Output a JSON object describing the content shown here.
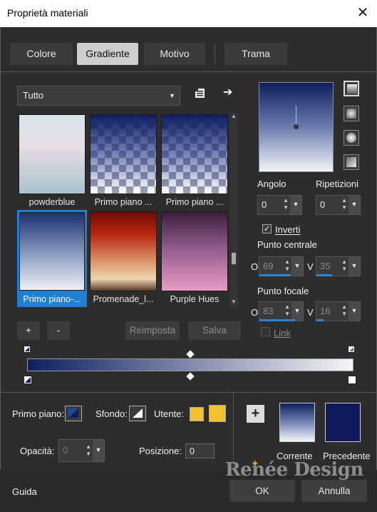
{
  "window": {
    "title": "Proprietà materiali",
    "close_glyph": "✕"
  },
  "tabs": [
    {
      "label": "Colore",
      "active": false
    },
    {
      "label": "Gradiente",
      "active": true
    },
    {
      "label": "Motivo",
      "active": false
    },
    {
      "label": "Trama",
      "active": false
    }
  ],
  "library": {
    "category": "Tutto",
    "items": [
      {
        "label": "powderblue"
      },
      {
        "label": "Primo piano ..."
      },
      {
        "label": "Primo piano ..."
      },
      {
        "label": "Primo piano-...",
        "selected": true
      },
      {
        "label": "Promenade_l..."
      },
      {
        "label": "Purple Hues"
      }
    ]
  },
  "buttons": {
    "add": "+",
    "remove": "-",
    "reset": "Reimposta",
    "save": "Salva"
  },
  "gradient": {
    "angle_label": "Angolo",
    "angle": "0",
    "repeats_label": "Ripetizioni",
    "repeats": "0",
    "invert_label": "Inverti",
    "invert_checked": true,
    "center_label": "Punto centrale",
    "center_h": "69",
    "center_v": "35",
    "focal_label": "Punto focale",
    "focal_h": "83",
    "focal_v": "16",
    "link_label": "Link",
    "h_prefix": "O",
    "v_prefix": "V",
    "colors": {
      "start": "#0f1f5e",
      "end": "#ffffff"
    }
  },
  "materials": {
    "foreground_label": "Primo piano:",
    "background_label": "Sfondo:",
    "user_label": "Utente:",
    "user_color": "#f2c12e",
    "opacity_label": "Opacità:",
    "opacity": "0",
    "position_label": "Posizione:",
    "position": "0",
    "current_label": "Corrente",
    "previous_label": "Precedente",
    "previous_color": "#0e1a5c"
  },
  "footer": {
    "help": "Guida",
    "ok": "OK",
    "cancel": "Annulla"
  },
  "watermark": "Renée Design"
}
